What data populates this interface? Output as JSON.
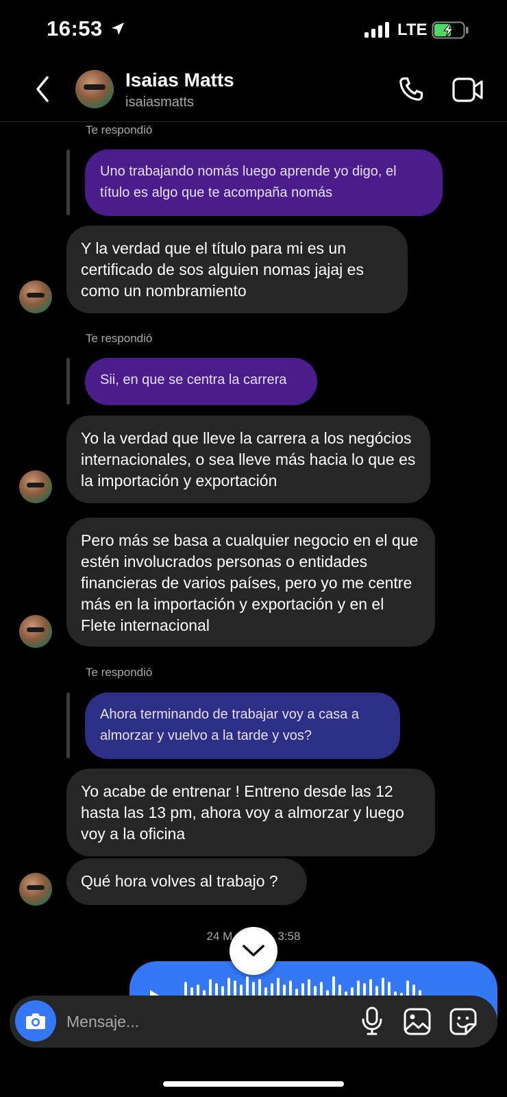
{
  "status_bar": {
    "time": "16:53",
    "network": "LTE"
  },
  "header": {
    "name": "Isaias Matts",
    "username": "isaiasmatts"
  },
  "messages": {
    "reply1_label": "Te respondió",
    "reply1_quote": "Uno trabajando nomás luego aprende yo digo, el título es algo que te acompaña nomás",
    "msg1": "Y la verdad que el título para mi es un certificado de sos alguien nomas jajaj es como un nombramiento",
    "reply2_label": "Te respondió",
    "reply2_quote": "Sii, en que se centra la carrera",
    "msg2": "Yo la verdad que lleve la carrera a los negócios internacionales, o sea lleve más hacia lo que es la importación y exportación",
    "msg3": "Pero más se basa a cualquier negocio en el que estén involucrados personas o entidades financieras de varios países, pero yo me centre más en la importación y exportación y en el Flete internacional",
    "reply3_label": "Te respondió",
    "reply3_quote": "Ahora terminando de trabajar voy a casa a almorzar y vuelvo a la tarde y vos?",
    "msg4": "Yo acabe de entrenar ! Entreno desde las 12 hasta las 13 pm, ahora voy a almorzar y luego voy a la oficina",
    "msg5": "Qué hora volves al trabajo ?"
  },
  "date_separator": {
    "left": "24 M",
    "right": "3:58"
  },
  "composer": {
    "placeholder": "Mensaje..."
  },
  "colors": {
    "background": "#000000",
    "incoming_bubble": "#262626",
    "quoted_purple": "#4a1c8c",
    "quoted_indigo": "#2d2f86",
    "voice_bubble": "#3478f6",
    "battery": "#4cd964"
  },
  "icons": [
    "location-arrow-icon",
    "signal-icon",
    "battery-charging-icon",
    "back-chevron-icon",
    "phone-icon",
    "video-camera-icon",
    "chevron-down-icon",
    "play-icon",
    "camera-icon",
    "microphone-icon",
    "image-gallery-icon",
    "sticker-icon"
  ]
}
